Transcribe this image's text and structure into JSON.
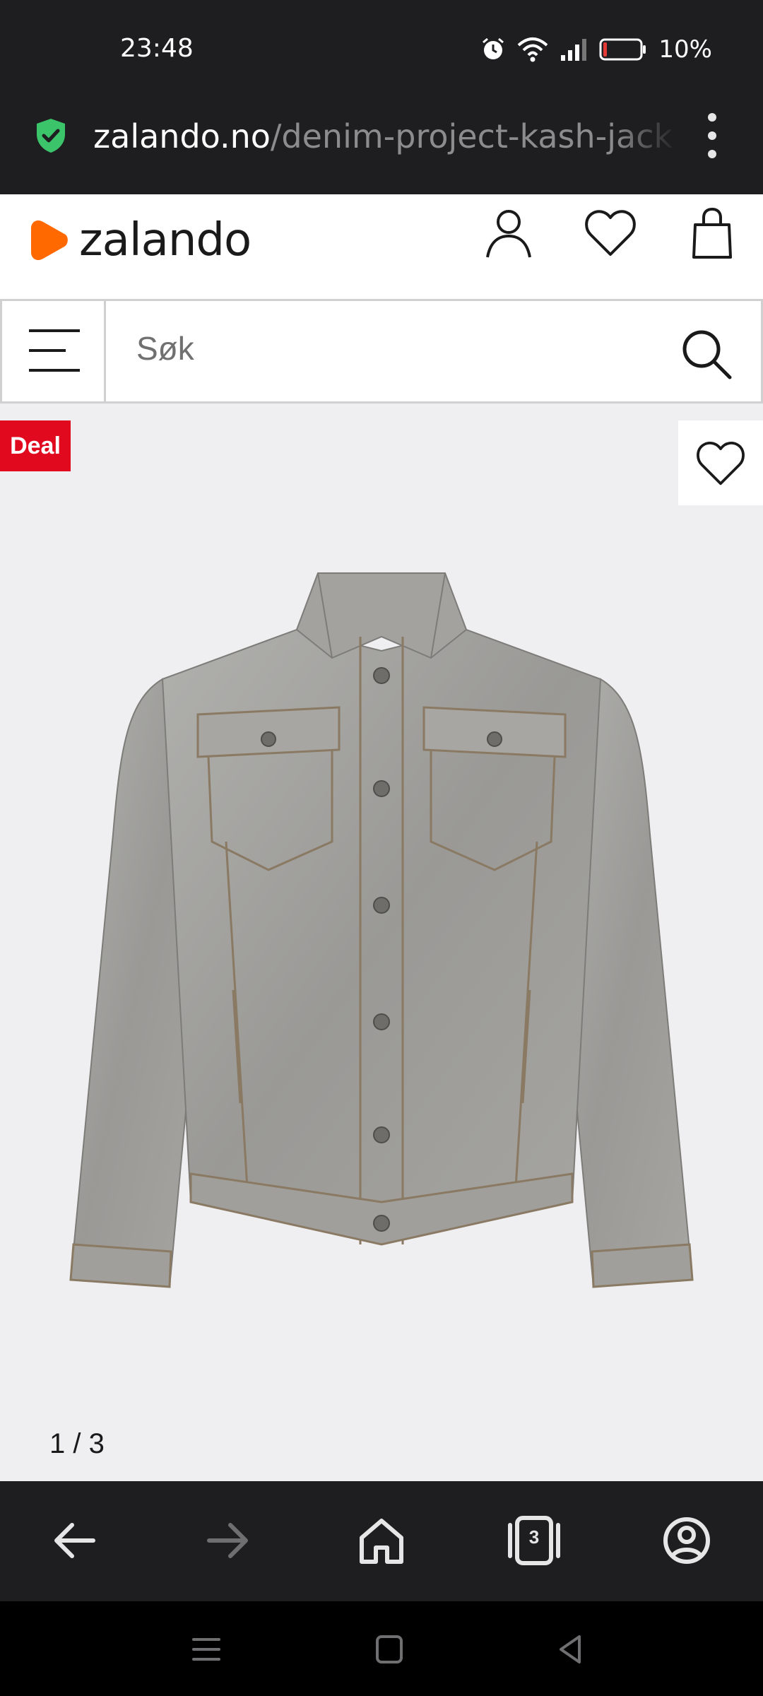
{
  "status_bar": {
    "time": "23:48",
    "battery_percent": "10%",
    "battery_level": 0.1,
    "icons": [
      "alarm-icon",
      "wifi-icon",
      "cell-signal-icon",
      "battery-icon"
    ]
  },
  "browser": {
    "url_domain": "zalando.no",
    "url_path": "/denim-project-kash-jack",
    "tabs_count": "3"
  },
  "site": {
    "brand": "zalando",
    "brand_color": "#ff6900",
    "header_icons": [
      "account-icon",
      "wishlist-icon",
      "bag-icon"
    ]
  },
  "search": {
    "placeholder": "Søk"
  },
  "product": {
    "badge": "Deal",
    "badge_color": "#e0091e",
    "image_counter": "1 / 3"
  }
}
